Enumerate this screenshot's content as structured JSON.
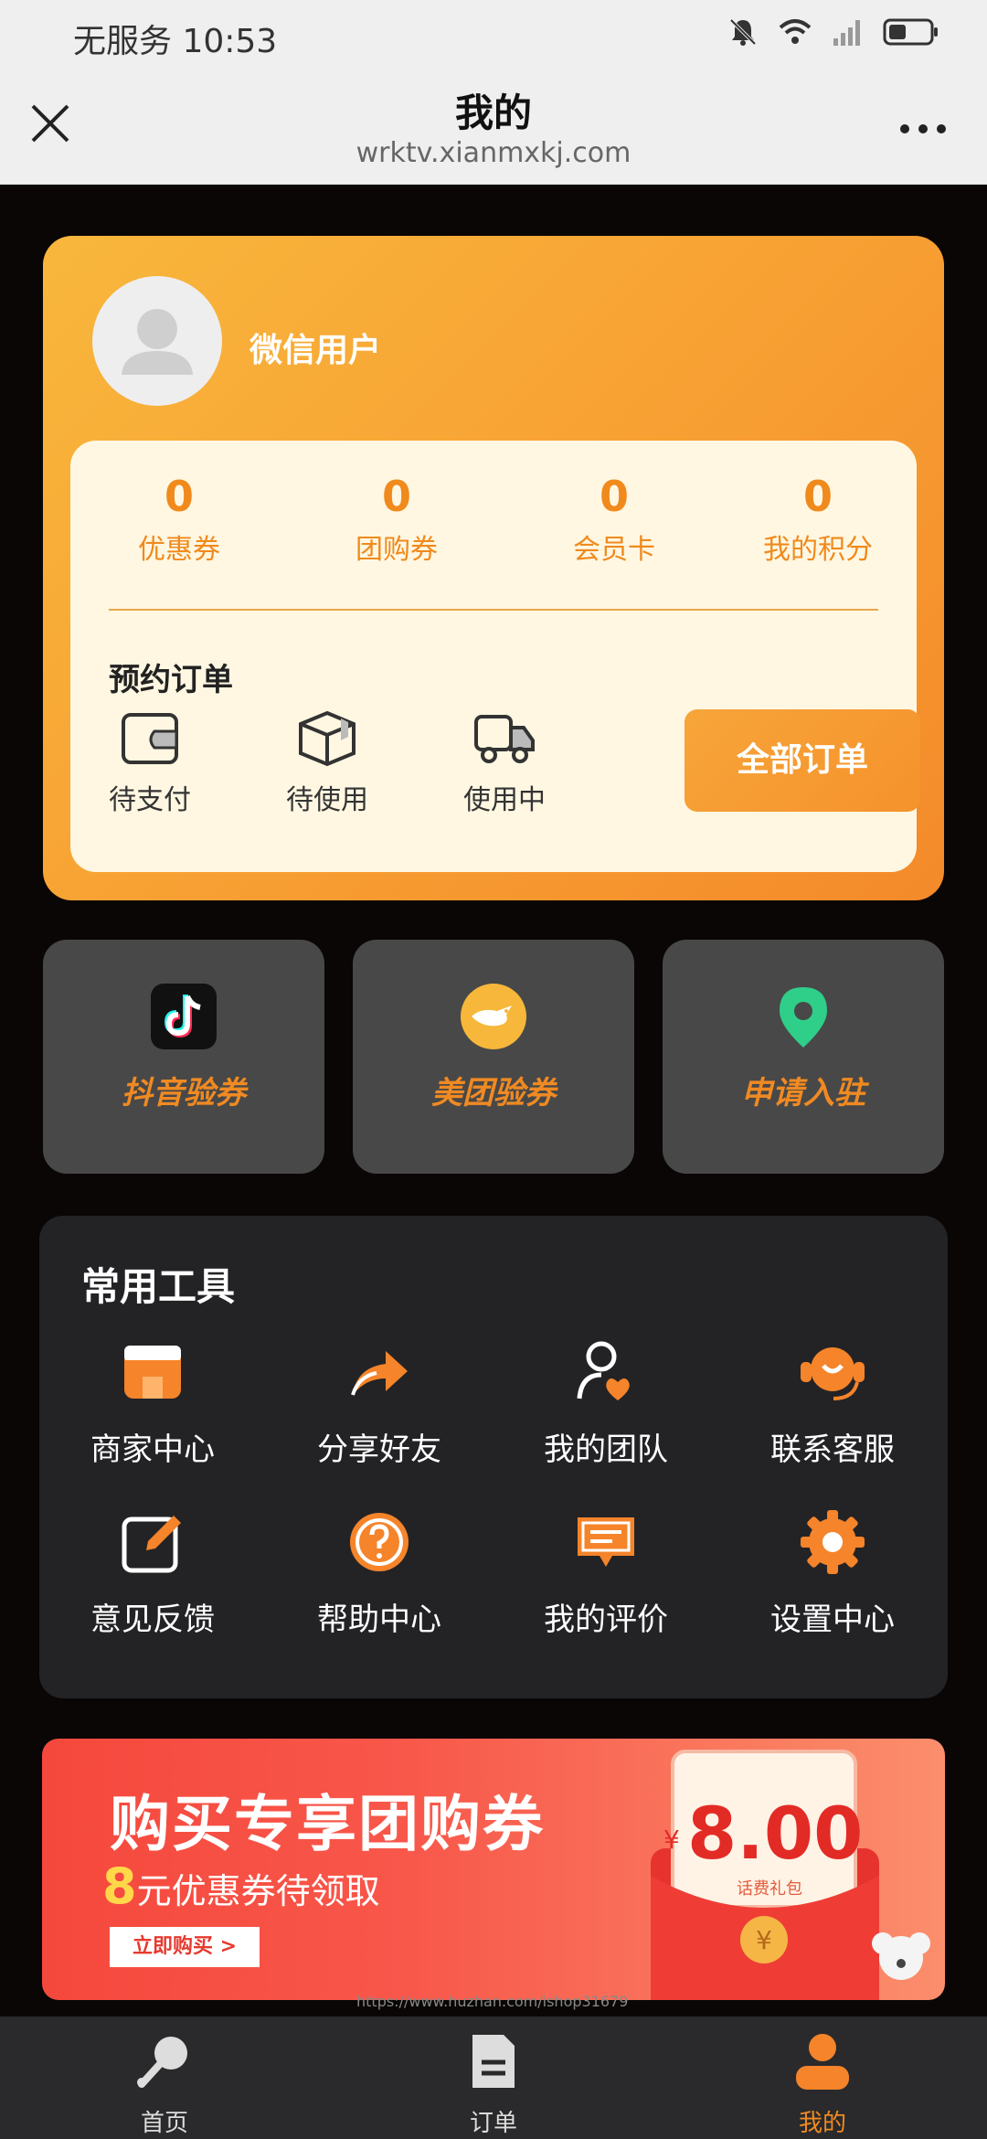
{
  "status_bar": {
    "carrier": "无服务",
    "time": "10:53"
  },
  "header": {
    "title": "我的",
    "url": "wrktv.xianmxkj.com"
  },
  "profile": {
    "username": "微信用户",
    "stats": [
      {
        "value": "0",
        "label": "优惠券"
      },
      {
        "value": "0",
        "label": "团购券"
      },
      {
        "value": "0",
        "label": "会员卡"
      },
      {
        "value": "0",
        "label": "我的积分"
      }
    ],
    "orders": {
      "title": "预约订单",
      "items": [
        {
          "label": "待支付",
          "icon": "wallet-icon"
        },
        {
          "label": "待使用",
          "icon": "box-icon"
        },
        {
          "label": "使用中",
          "icon": "truck-icon"
        }
      ],
      "all_button": "全部订单"
    }
  },
  "vouchers": [
    {
      "label": "抖音验券",
      "icon": "tiktok-icon"
    },
    {
      "label": "美团验券",
      "icon": "meituan-icon"
    },
    {
      "label": "申请入驻",
      "icon": "location-pin-icon"
    }
  ],
  "tools": {
    "title": "常用工具",
    "items": [
      {
        "label": "商家中心",
        "icon": "shop-icon"
      },
      {
        "label": "分享好友",
        "icon": "share-icon"
      },
      {
        "label": "我的团队",
        "icon": "team-icon"
      },
      {
        "label": "联系客服",
        "icon": "headset-icon"
      },
      {
        "label": "意见反馈",
        "icon": "feedback-icon"
      },
      {
        "label": "帮助中心",
        "icon": "help-icon"
      },
      {
        "label": "我的评价",
        "icon": "comment-icon"
      },
      {
        "label": "设置中心",
        "icon": "settings-icon"
      }
    ]
  },
  "banner": {
    "title": "购买专享团购券",
    "sub_number": "8",
    "sub_text": "元优惠券待领取",
    "button": "立即购买 >",
    "amount": "8.00",
    "currency": "¥",
    "note": "话费礼包"
  },
  "watermark": "https://www.huzhan.com/ishop31679",
  "tabbar": {
    "tabs": [
      {
        "label": "首页",
        "icon": "home-icon",
        "active": false
      },
      {
        "label": "订单",
        "icon": "orders-icon",
        "active": false
      },
      {
        "label": "我的",
        "icon": "profile-icon",
        "active": true
      }
    ]
  },
  "colors": {
    "accent": "#f08a22",
    "card_bg": "#fff7e2",
    "panel_bg": "#232326"
  }
}
